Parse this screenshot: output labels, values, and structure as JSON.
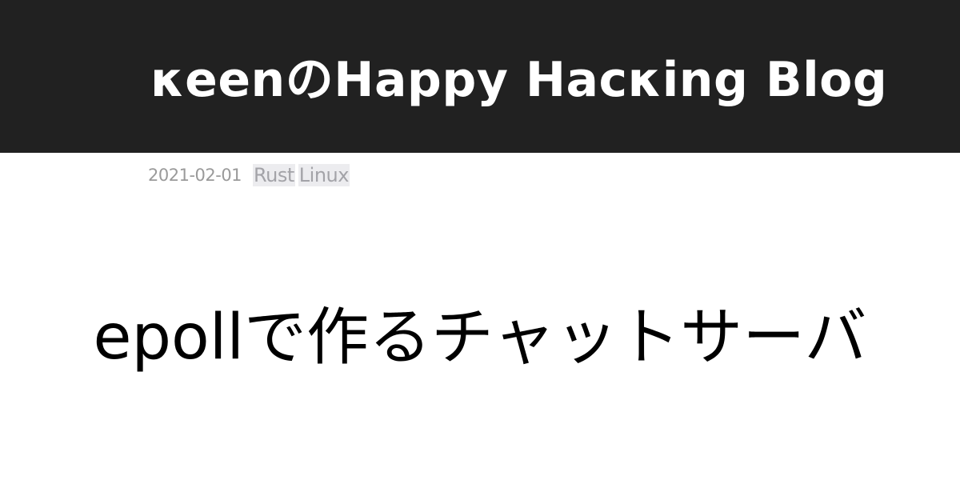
{
  "header": {
    "blog_title": "κeenのHappy Hacκing Blog"
  },
  "meta": {
    "date": "2021-02-01",
    "tags": [
      "Rust",
      "Linux"
    ]
  },
  "post": {
    "title": "epollで作るチャットサーバ"
  },
  "colors": {
    "header_bg": "#212121",
    "header_text": "#ffffff",
    "meta_text": "#9a9a9a",
    "tag_bg": "#ececef",
    "title_text": "#000000"
  }
}
